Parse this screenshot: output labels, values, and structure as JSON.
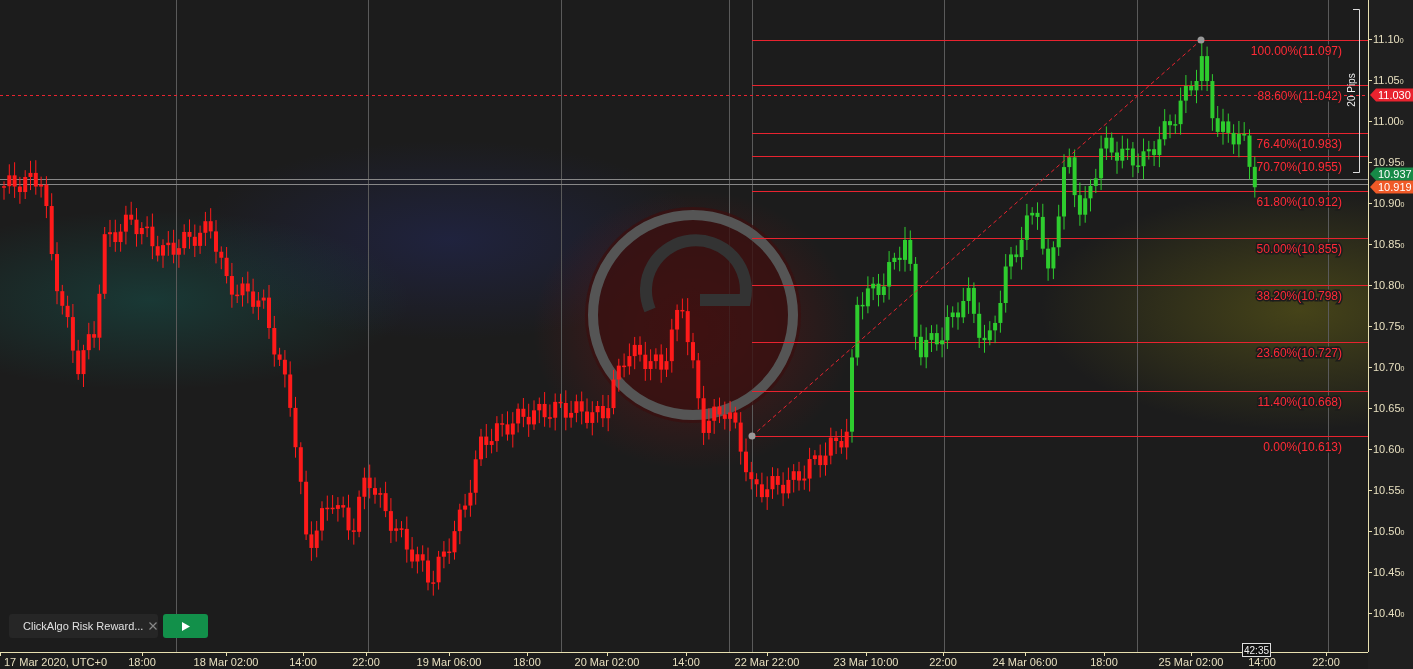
{
  "price_axis": {
    "labels": [
      "11.10$_{0}$",
      "11.05$_{0}$",
      "11.00$_{0}$",
      "10.95$_{0}$",
      "10.90$_{0}$",
      "10.85$_{0}$",
      "10.80$_{0}$",
      "10.75$_{0}$",
      "10.70$_{0}$",
      "10.65$_{0}$",
      "10.60$_{0}$",
      "10.55$_{0}$",
      "10.50$_{0}$",
      "10.45$_{0}$",
      "10.40$_{0}$"
    ]
  },
  "time_axis": {
    "labels": [
      "17 Mar 2020, UTC+0",
      "18:00",
      "18 Mar 02:00",
      "14:00",
      "22:00",
      "19 Mar 06:00",
      "18:00",
      "20 Mar 02:00",
      "14:00",
      "22 Mar 22:00",
      "23 Mar 10:00",
      "22:00",
      "24 Mar 06:00",
      "18:00",
      "25 Mar 02:00",
      "14:00",
      "22:00"
    ]
  },
  "fibonacci_levels": [
    {
      "label": "100.00%(11.097)"
    },
    {
      "label": "88.60%(11.042)"
    },
    {
      "label": "76.40%(10.983)"
    },
    {
      "label": "70.70%(10.955)"
    },
    {
      "label": "61.80%(10.912)"
    },
    {
      "label": "50.00%(10.855)"
    },
    {
      "label": "38.20%(10.798)"
    },
    {
      "label": "23.60%(10.727)"
    },
    {
      "label": "11.40%(10.668)"
    },
    {
      "label": "0.00%(10.613)"
    }
  ],
  "price_tags": [
    {
      "text": "11.030",
      "color": "#e8232f"
    },
    {
      "text": "10.937",
      "color": "#178a47"
    },
    {
      "text": "10.919",
      "color": "#f05a28"
    }
  ],
  "pips_bracket": {
    "label": "20 Pips"
  },
  "bar_timer": "42:35",
  "indicator": {
    "name": "ClickAlgo Risk Reward..."
  }
}
